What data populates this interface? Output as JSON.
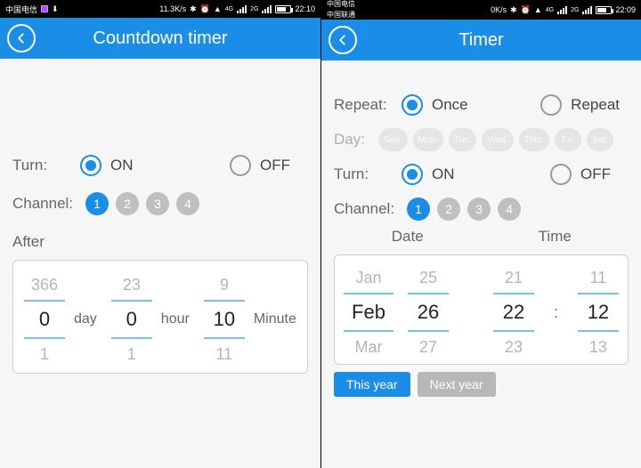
{
  "left": {
    "statusbar": {
      "carrier": "中国电信",
      "speed": "11.3K/s",
      "net1": "4G",
      "net2": "2G",
      "time": "22:10"
    },
    "title": "Countdown timer",
    "turn": {
      "label": "Turn:",
      "on": "ON",
      "off": "OFF",
      "selected": "on"
    },
    "channel": {
      "label": "Channel:",
      "items": [
        "1",
        "2",
        "3",
        "4"
      ],
      "selected": 0
    },
    "after_label": "After",
    "picker": {
      "day": {
        "prev": "366",
        "cur": "0",
        "next": "1",
        "unit": "day"
      },
      "hour": {
        "prev": "23",
        "cur": "0",
        "next": "1",
        "unit": "hour"
      },
      "minute": {
        "prev": "9",
        "cur": "10",
        "next": "11",
        "unit": "Minute"
      }
    }
  },
  "right": {
    "statusbar": {
      "carrier_top": "中国电信",
      "carrier_bot": "中国联通",
      "speed": "0K/s",
      "net1": "4G",
      "net2": "2G",
      "time": "22:09"
    },
    "title": "Timer",
    "repeat": {
      "label": "Repeat:",
      "once": "Once",
      "repeat": "Repeat",
      "selected": "once"
    },
    "day": {
      "label": "Day:",
      "items": [
        "Sun.",
        "Mon.",
        "Tue.",
        "Wed.",
        "Thur.",
        "Fri.",
        "Sat."
      ]
    },
    "turn": {
      "label": "Turn:",
      "on": "ON",
      "off": "OFF",
      "selected": "on"
    },
    "channel": {
      "label": "Channel:",
      "items": [
        "1",
        "2",
        "3",
        "4"
      ],
      "selected": 0
    },
    "headers": {
      "date": "Date",
      "time": "Time"
    },
    "picker": {
      "month": {
        "prev": "Jan",
        "cur": "Feb",
        "next": "Mar"
      },
      "dom": {
        "prev": "25",
        "cur": "26",
        "next": "27"
      },
      "hour": {
        "prev": "21",
        "cur": "22",
        "next": "23"
      },
      "minute": {
        "prev": "11",
        "cur": "12",
        "next": "13"
      }
    },
    "year_buttons": {
      "this": "This year",
      "next": "Next year",
      "selected": "this"
    }
  }
}
